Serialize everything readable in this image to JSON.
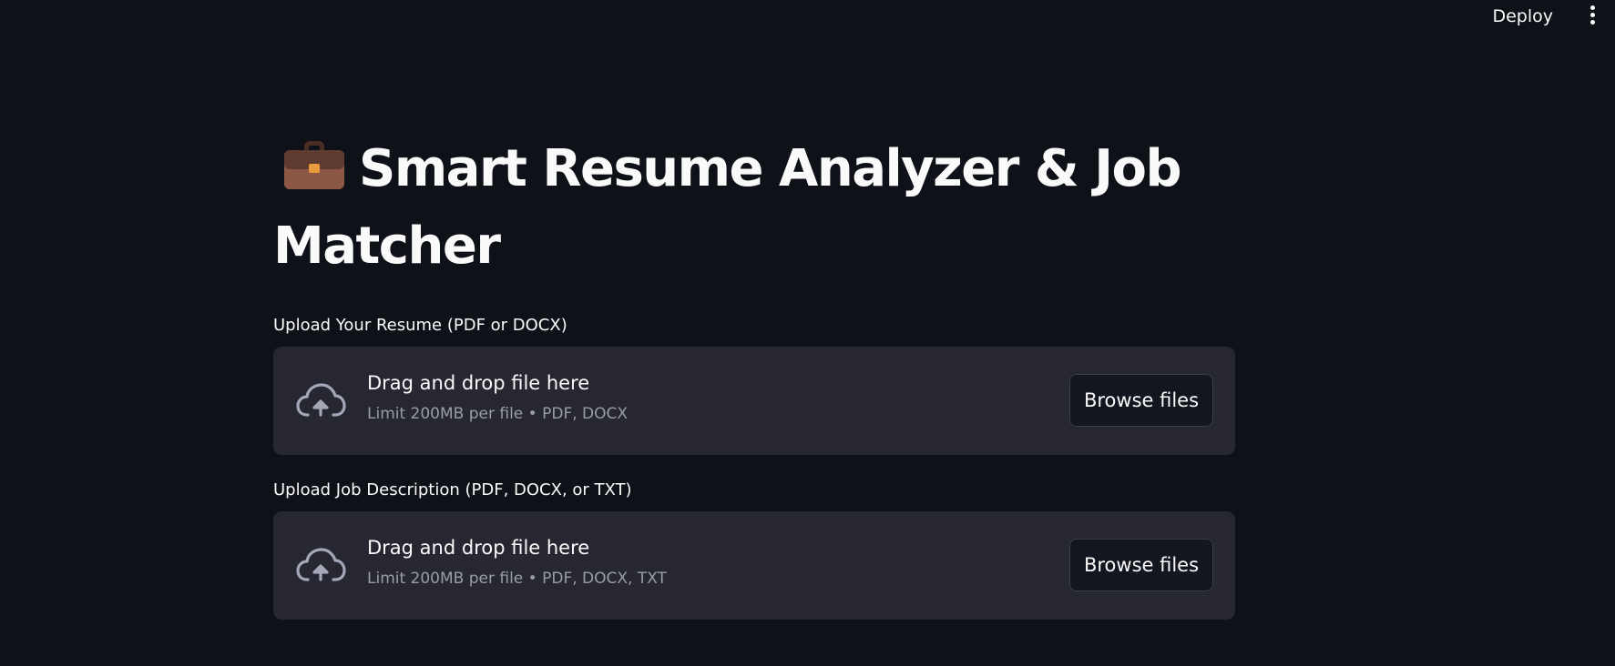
{
  "header": {
    "deploy_label": "Deploy",
    "menu_icon": "kebab-menu-icon"
  },
  "page": {
    "title_icon": "briefcase-icon",
    "title": "Smart Resume Analyzer & Job Matcher"
  },
  "uploaders": [
    {
      "label": "Upload Your Resume (PDF or DOCX)",
      "drop_text": "Drag and drop file here",
      "limit_text": "Limit 200MB per file • PDF, DOCX",
      "browse_label": "Browse files",
      "icon": "cloud-upload-icon"
    },
    {
      "label": "Upload Job Description (PDF, DOCX, or TXT)",
      "drop_text": "Drag and drop file here",
      "limit_text": "Limit 200MB per file • PDF, DOCX, TXT",
      "browse_label": "Browse files",
      "icon": "cloud-upload-icon"
    }
  ],
  "colors": {
    "background": "#0e1117",
    "dropzone": "#262730",
    "text": "#fafafa",
    "muted_text": "#9a9ca6"
  }
}
